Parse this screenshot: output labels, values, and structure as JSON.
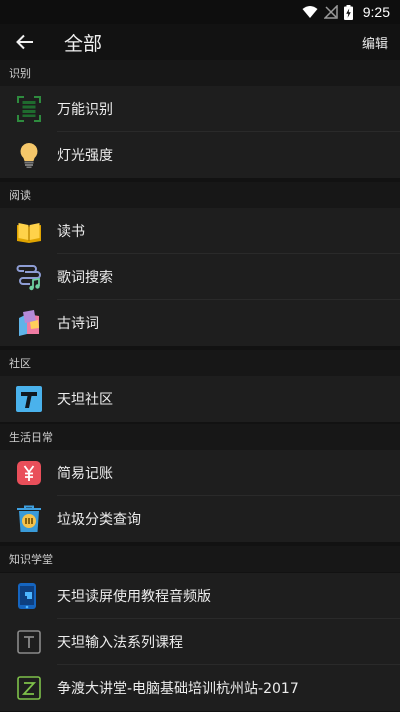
{
  "status_bar": {
    "time": "9:25"
  },
  "app_bar": {
    "title": "全部",
    "edit_label": "编辑"
  },
  "sections": [
    {
      "title": "识别",
      "items": [
        {
          "label": "万能识别",
          "icon": "scan-icon"
        },
        {
          "label": "灯光强度",
          "icon": "bulb-icon"
        }
      ]
    },
    {
      "title": "阅读",
      "items": [
        {
          "label": "读书",
          "icon": "book-icon"
        },
        {
          "label": "歌词搜索",
          "icon": "lyrics-icon"
        },
        {
          "label": "古诗词",
          "icon": "poetry-icon"
        }
      ]
    },
    {
      "title": "社区",
      "items": [
        {
          "label": "天坦社区",
          "icon": "community-icon"
        }
      ]
    },
    {
      "title": "生活日常",
      "items": [
        {
          "label": "简易记账",
          "icon": "ledger-icon"
        },
        {
          "label": "垃圾分类查询",
          "icon": "trash-icon"
        }
      ]
    },
    {
      "title": "知识学堂",
      "items": [
        {
          "label": "天坦读屏使用教程音频版",
          "icon": "phone-tutorial-icon"
        },
        {
          "label": "天坦输入法系列课程",
          "icon": "input-method-icon"
        },
        {
          "label": "争渡大讲堂-电脑基础培训杭州站-2017",
          "icon": "lecture-icon"
        }
      ]
    }
  ],
  "colors": {
    "background": "#121212",
    "item_background": "#1e1e1e",
    "section_background": "#171717"
  }
}
